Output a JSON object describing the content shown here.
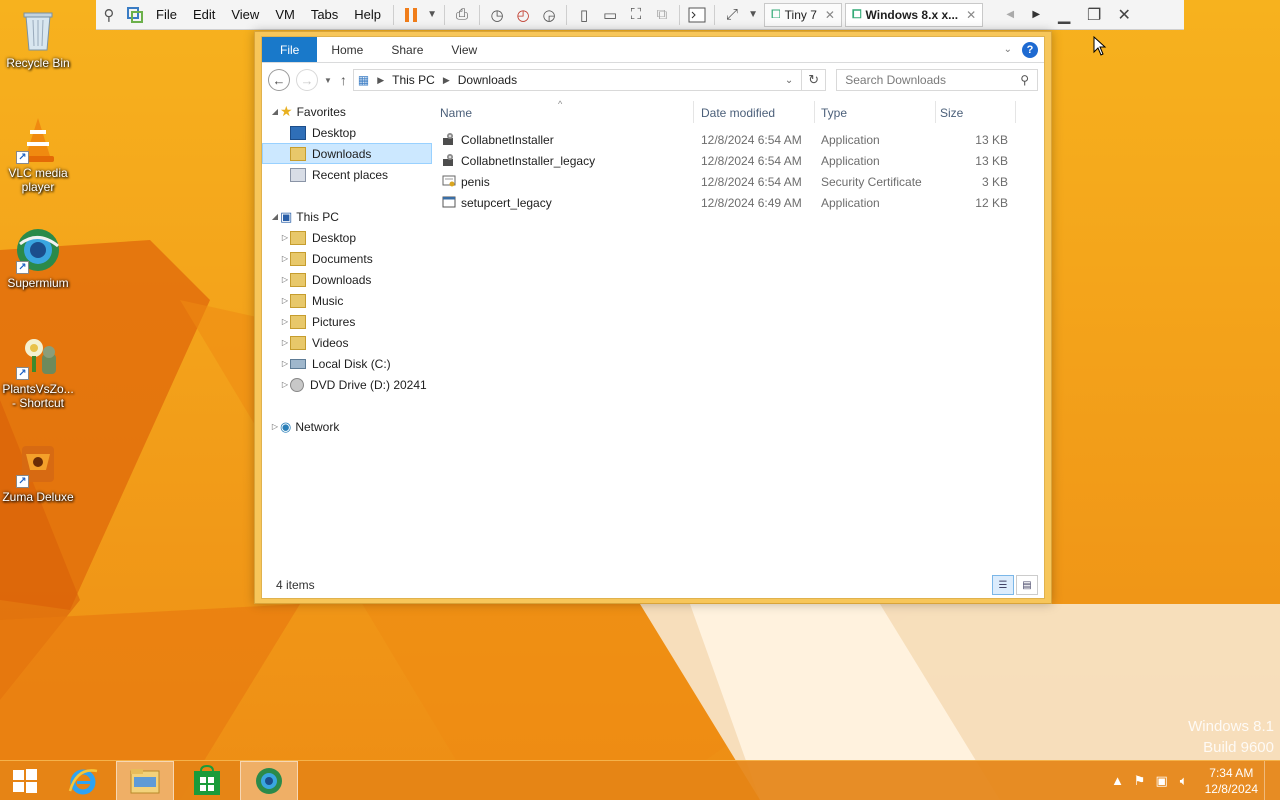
{
  "desktop": {
    "icons": [
      {
        "label": "Recycle Bin"
      },
      {
        "label": "VLC media player"
      },
      {
        "label": "Supermium"
      },
      {
        "label": "PlantsVsZo... - Shortcut"
      },
      {
        "label": "Zuma Deluxe"
      }
    ],
    "watermark": {
      "line1": "Windows 8.1",
      "line2": "Build 9600"
    }
  },
  "vmware": {
    "menus": [
      "File",
      "Edit",
      "View",
      "VM",
      "Tabs",
      "Help"
    ],
    "tabs": [
      {
        "label": "Tiny 7",
        "active": false
      },
      {
        "label": "Windows 8.x x...",
        "active": true
      }
    ]
  },
  "explorer": {
    "ribbon_tabs": [
      "File",
      "Home",
      "Share",
      "View"
    ],
    "help_label": "?",
    "address": {
      "crumbs": [
        "This PC",
        "Downloads"
      ]
    },
    "search": {
      "placeholder": "Search Downloads"
    },
    "nav": {
      "favorites": {
        "label": "Favorites",
        "items": [
          "Desktop",
          "Downloads",
          "Recent places"
        ]
      },
      "this_pc": {
        "label": "This PC",
        "items": [
          "Desktop",
          "Documents",
          "Downloads",
          "Music",
          "Pictures",
          "Videos",
          "Local Disk (C:)",
          "DVD Drive (D:) 20241"
        ]
      },
      "network": {
        "label": "Network"
      },
      "selected": "Downloads"
    },
    "columns": {
      "name": "Name",
      "date": "Date modified",
      "type": "Type",
      "size": "Size"
    },
    "files": [
      {
        "name": "CollabnetInstaller",
        "date": "12/8/2024 6:54 AM",
        "type": "Application",
        "size": "13 KB",
        "icon": "installer-icon"
      },
      {
        "name": "CollabnetInstaller_legacy",
        "date": "12/8/2024 6:54 AM",
        "type": "Application",
        "size": "13 KB",
        "icon": "installer-icon"
      },
      {
        "name": "penis",
        "date": "12/8/2024 6:54 AM",
        "type": "Security Certificate",
        "size": "3 KB",
        "icon": "certificate-icon"
      },
      {
        "name": "setupcert_legacy",
        "date": "12/8/2024 6:49 AM",
        "type": "Application",
        "size": "12 KB",
        "icon": "application-icon"
      }
    ],
    "status": {
      "items_count": "4 items"
    }
  },
  "taskbar": {
    "clock": {
      "time": "7:34 AM",
      "date": "12/8/2024"
    }
  },
  "colors": {
    "accent": "#1979ca",
    "desktop_orange": "#f3a21a",
    "selection": "#cce8ff"
  }
}
